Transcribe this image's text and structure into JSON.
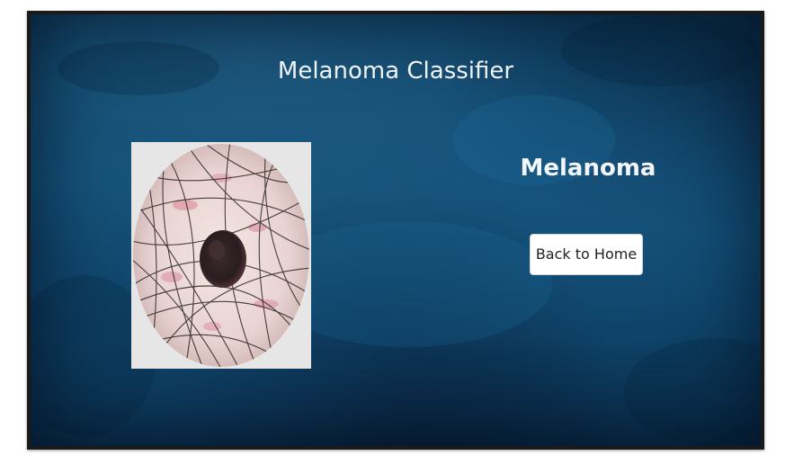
{
  "app": {
    "title": "Melanoma Classifier"
  },
  "result": {
    "label": "Melanoma"
  },
  "actions": {
    "back_home_label": "Back to Home"
  },
  "colors": {
    "background": "#125178",
    "title_text": "#eef3f7",
    "button_bg": "#ffffff",
    "button_text": "#222222"
  }
}
